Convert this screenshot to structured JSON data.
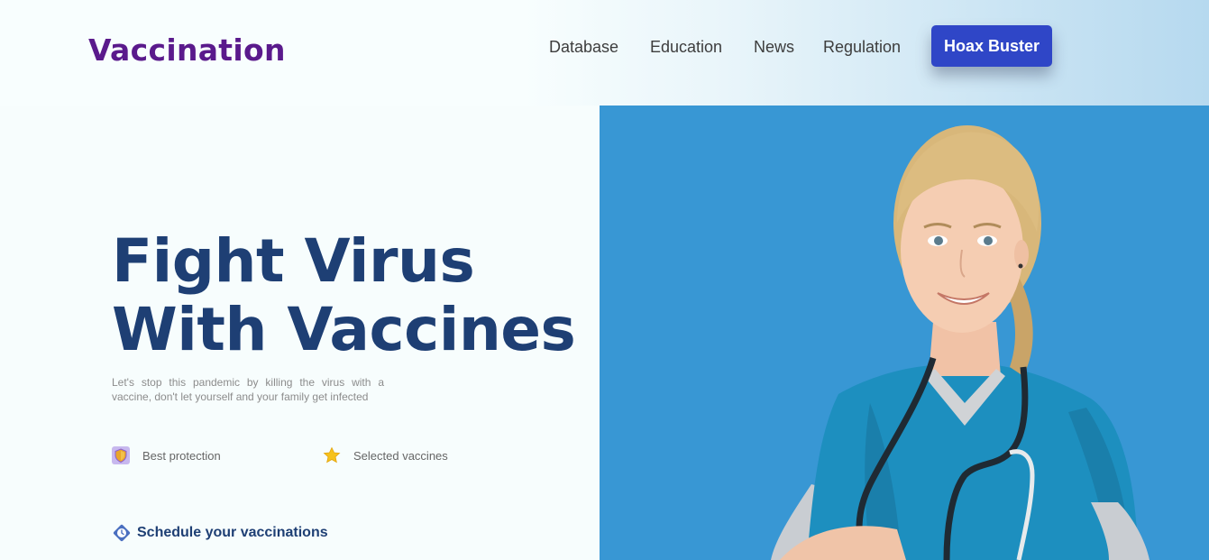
{
  "brand": {
    "name": "Vaccination"
  },
  "nav": {
    "items": [
      {
        "label": "Database"
      },
      {
        "label": "Education"
      },
      {
        "label": "News"
      },
      {
        "label": "Regulation"
      }
    ],
    "cta_label": "Hoax Buster"
  },
  "hero": {
    "headline_line1": "Fight Virus",
    "headline_line2": "With Vaccines",
    "subtext": "Let's stop this pandemic by killing the virus with a vaccine, don't let yourself and your family get infected",
    "features": [
      {
        "label": "Best protection",
        "icon": "shield-icon"
      },
      {
        "label": "Selected vaccines",
        "icon": "star-icon"
      }
    ],
    "schedule_link": {
      "label": "Schedule your vaccinations",
      "icon": "clock-icon"
    }
  },
  "colors": {
    "brand": "#5a1a8c",
    "headline": "#1e3f74",
    "cta": "#2f46c7",
    "panel": "#3897d4"
  }
}
